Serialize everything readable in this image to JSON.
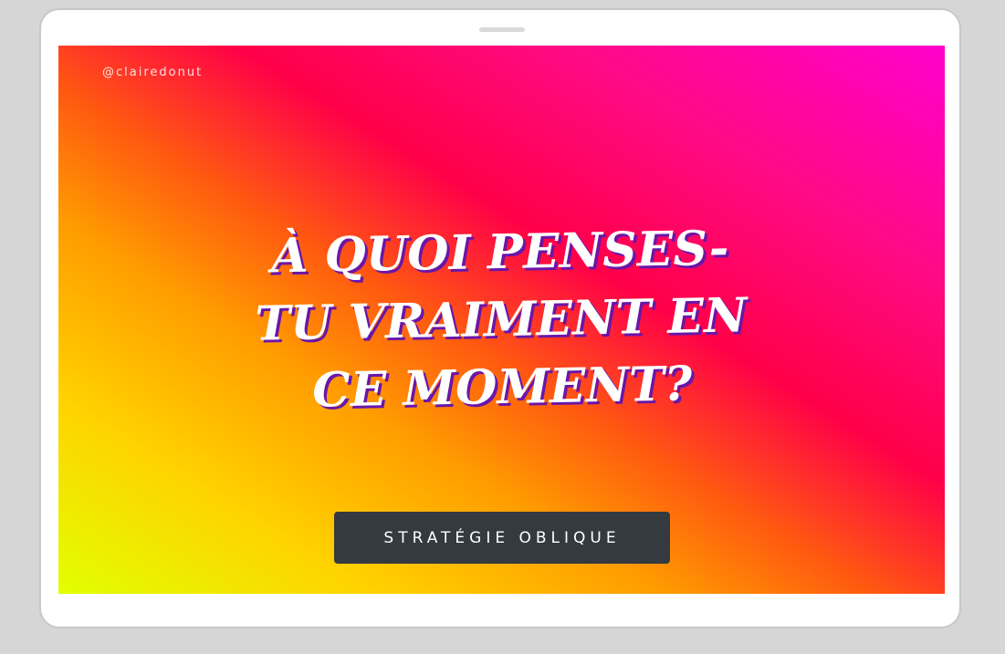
{
  "screen": {
    "handle": "@clairedonut",
    "question": "À quoi penses-tu vraiment en ce moment?",
    "button_label": "STRATÉGIE OBLIQUE"
  },
  "colors": {
    "background": "#d6d6d6",
    "device": "#ffffff",
    "gradient_start": "#e2ff00",
    "gradient_mid": "#ff0048",
    "gradient_end": "#ff00cc",
    "text_shadow": "#6a16a8",
    "button": "#343a40"
  }
}
